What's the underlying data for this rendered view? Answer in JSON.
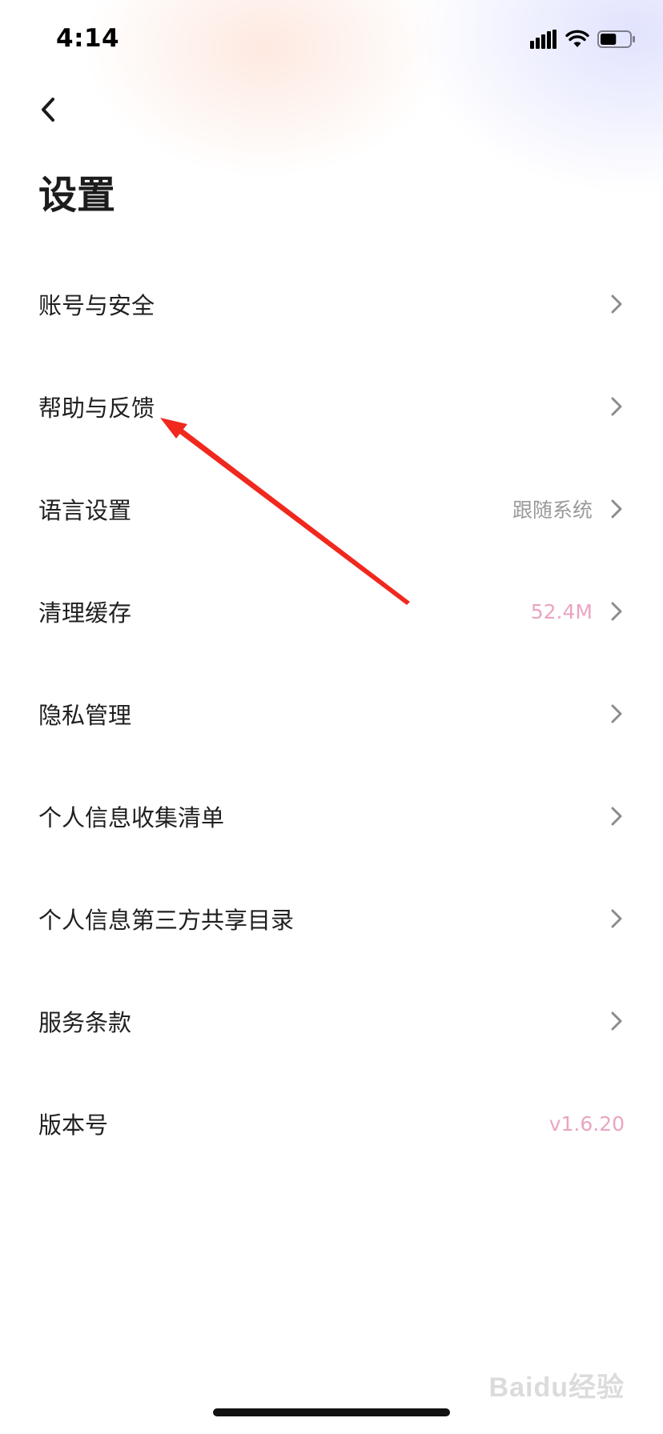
{
  "status_bar": {
    "time": "4:14",
    "battery_level": 0.55
  },
  "header": {
    "title": "设置"
  },
  "menu": {
    "items": [
      {
        "label": "账号与安全",
        "value": ""
      },
      {
        "label": "帮助与反馈",
        "value": ""
      },
      {
        "label": "语言设置",
        "value": "跟随系统"
      },
      {
        "label": "清理缓存",
        "value": "52.4M"
      },
      {
        "label": "隐私管理",
        "value": ""
      },
      {
        "label": "个人信息收集清单",
        "value": ""
      },
      {
        "label": "个人信息第三方共享目录",
        "value": ""
      },
      {
        "label": "服务条款",
        "value": ""
      },
      {
        "label": "版本号",
        "value": "v1.6.20"
      }
    ]
  },
  "watermark": {
    "text": "Baidu经验"
  },
  "colors": {
    "accent_pink": "#e9a5c2",
    "muted_gray": "#9a9a9a",
    "arrow_red": "#f0281e"
  }
}
